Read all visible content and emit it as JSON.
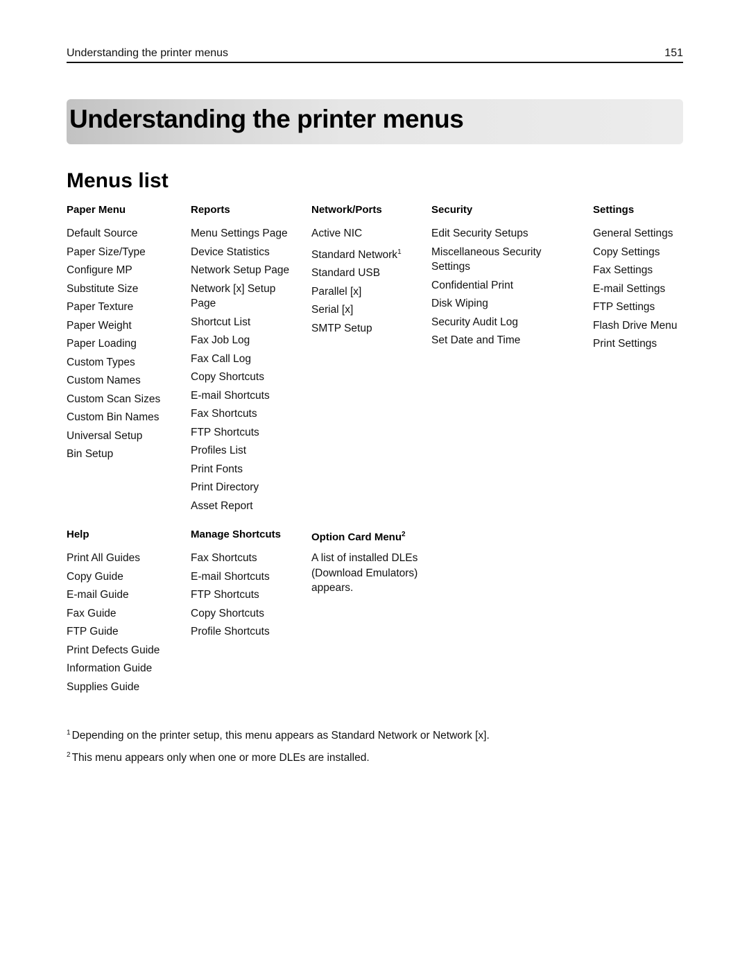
{
  "running_header": {
    "title": "Understanding the printer menus",
    "page_number": "151"
  },
  "banner": {
    "title": "Understanding the printer menus"
  },
  "section": {
    "title": "Menus list"
  },
  "menus": {
    "paper_menu": {
      "heading": "Paper Menu",
      "items": [
        "Default Source",
        "Paper Size/Type",
        "Configure MP",
        "Substitute Size",
        "Paper Texture",
        "Paper Weight",
        "Paper Loading",
        "Custom Types",
        "Custom Names",
        "Custom Scan Sizes",
        "Custom Bin Names",
        "Universal Setup",
        "Bin Setup"
      ]
    },
    "reports": {
      "heading": "Reports",
      "items": [
        "Menu Settings Page",
        "Device Statistics",
        "Network Setup Page",
        "Network [x] Setup Page",
        "Shortcut List",
        "Fax Job Log",
        "Fax Call Log",
        "Copy Shortcuts",
        "E-mail Shortcuts",
        "Fax Shortcuts",
        "FTP Shortcuts",
        "Profiles List",
        "Print Fonts",
        "Print Directory",
        "Asset Report"
      ]
    },
    "network_ports": {
      "heading": "Network/Ports",
      "items": [
        "Active NIC",
        "Standard Network",
        "Standard USB",
        "Parallel [x]",
        "Serial [x]",
        "SMTP Setup"
      ],
      "footnote_ref_item": "Standard Network",
      "footnote_ref": "1"
    },
    "security": {
      "heading": "Security",
      "items": [
        "Edit Security Setups",
        "Miscellaneous Security Settings",
        "Confidential Print",
        "Disk Wiping",
        "Security Audit Log",
        "Set Date and Time"
      ]
    },
    "settings": {
      "heading": "Settings",
      "items": [
        "General Settings",
        "Copy Settings",
        "Fax Settings",
        "E-mail Settings",
        "FTP Settings",
        "Flash Drive Menu",
        "Print Settings"
      ]
    },
    "help": {
      "heading": "Help",
      "items": [
        "Print All Guides",
        "Copy Guide",
        "E-mail Guide",
        "Fax Guide",
        "FTP Guide",
        "Print Defects Guide",
        "Information Guide",
        "Supplies Guide"
      ]
    },
    "manage_shortcuts": {
      "heading": "Manage Shortcuts",
      "items": [
        "Fax Shortcuts",
        "E-mail Shortcuts",
        "FTP Shortcuts",
        "Copy Shortcuts",
        "Profile Shortcuts"
      ]
    },
    "option_card_menu": {
      "heading": "Option Card Menu",
      "heading_footnote_ref": "2",
      "description": "A list of installed DLEs (Download Emulators) appears."
    }
  },
  "footnotes": [
    {
      "marker": "1",
      "text": "Depending on the printer setup, this menu appears as Standard Network or Network [x]."
    },
    {
      "marker": "2",
      "text": "This menu appears only when one or more DLEs are installed."
    }
  ]
}
